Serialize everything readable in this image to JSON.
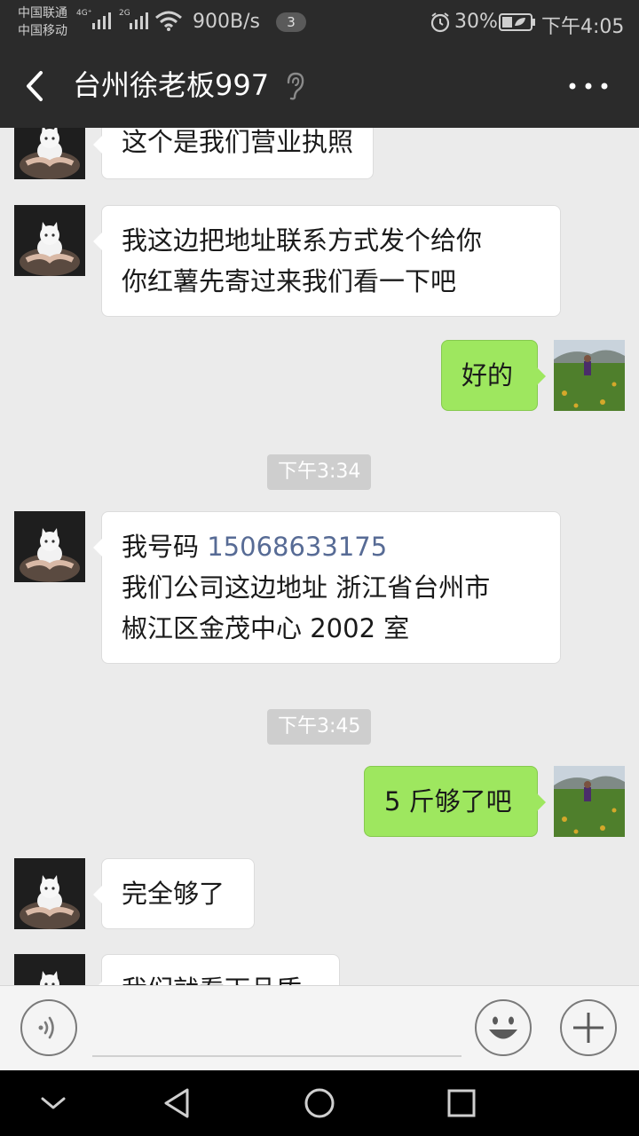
{
  "status_bar": {
    "carrier_1": "中国联通",
    "carrier_2": "中国移动",
    "network_1": "4G⁺",
    "network_2": "2G",
    "net_speed": "900B/s",
    "notification_count": "3",
    "battery_percent": "30%",
    "time": "下午4:05"
  },
  "header": {
    "title": "台州徐老板997"
  },
  "messages": [
    {
      "from": "them",
      "lines": [
        "这个是我们营业执照"
      ]
    },
    {
      "from": "them",
      "lines": [
        "我这边把地址联系方式发个给你",
        "你红薯先寄过来我们看一下吧"
      ]
    },
    {
      "from": "me",
      "lines": [
        "好的"
      ]
    },
    {
      "type": "timestamp",
      "text": "下午3:34"
    },
    {
      "from": "them",
      "prefix": "我号码 ",
      "phone": "15068633175",
      "lines": [
        "我们公司这边地址  浙江省台州市",
        "椒江区金茂中心 2002 室"
      ]
    },
    {
      "type": "timestamp",
      "text": "下午3:45"
    },
    {
      "from": "me",
      "lines": [
        "5 斤够了吧"
      ]
    },
    {
      "from": "them",
      "lines": [
        "完全够了"
      ]
    },
    {
      "from": "them",
      "lines": [
        "我们就看下品质"
      ]
    }
  ],
  "input_bar": {
    "placeholder": ""
  },
  "colors": {
    "title_bar": "#2b2b2b",
    "chat_background": "#ebebeb",
    "outgoing_bubble": "#9ee75f",
    "incoming_bubble": "#ffffff",
    "link": "#576b95",
    "timestamp_bg": "#cecece"
  }
}
